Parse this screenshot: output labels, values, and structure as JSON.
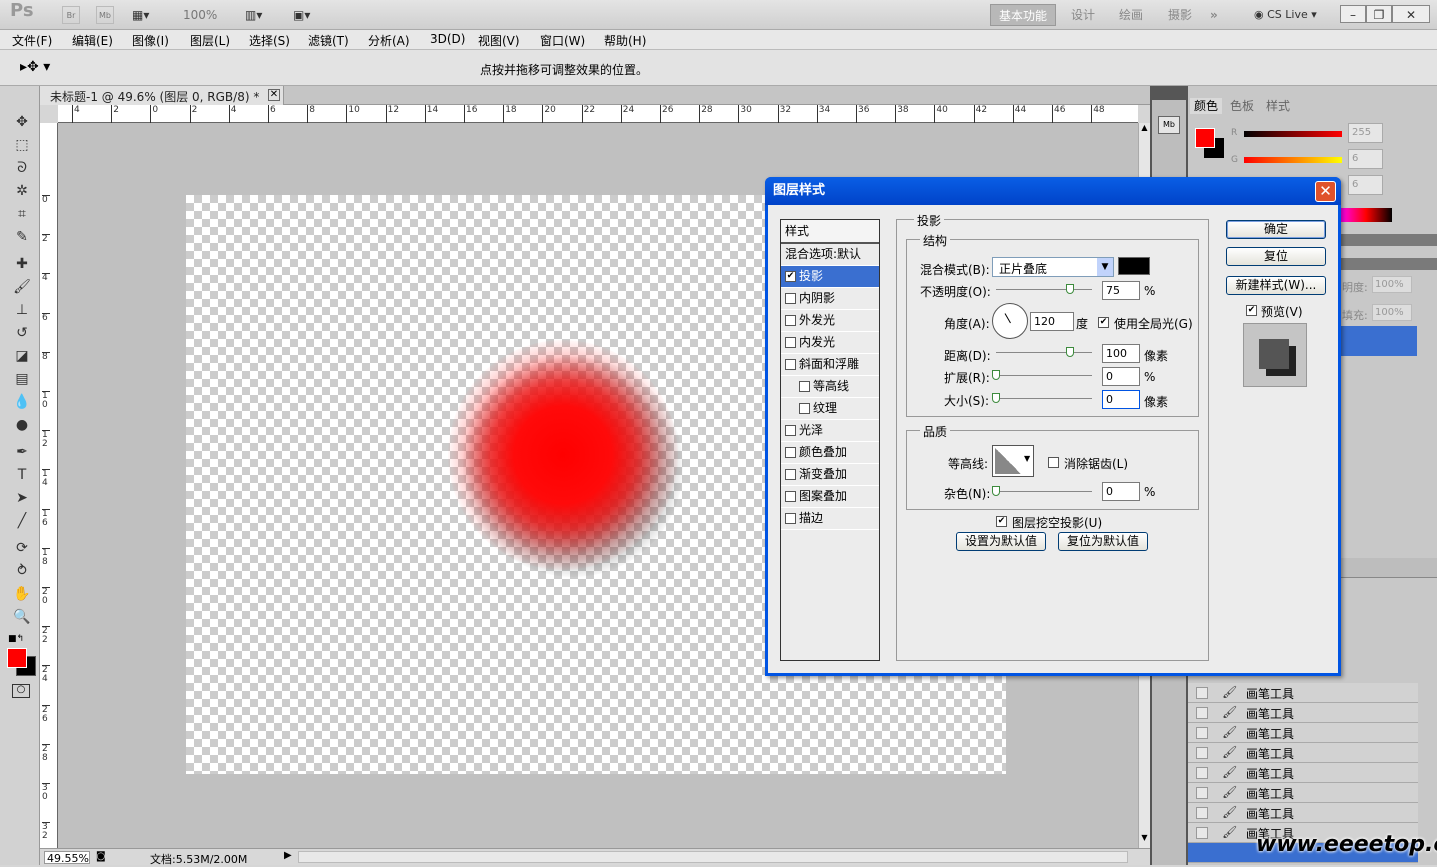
{
  "app": {
    "logo": "Ps",
    "zoom": "100%",
    "cslive": "CS Live"
  },
  "workspaces": [
    "基本功能",
    "设计",
    "绘画",
    "摄影"
  ],
  "menu": [
    "文件(F)",
    "编辑(E)",
    "图像(I)",
    "图层(L)",
    "选择(S)",
    "滤镜(T)",
    "分析(A)",
    "3D(D)",
    "视图(V)",
    "窗口(W)",
    "帮助(H)"
  ],
  "options_hint": "点按并拖移可调整效果的位置。",
  "document": {
    "tab_title": "未标题-1 @ 49.6% (图层 0, RGB/8) *",
    "zoom": "49.55%",
    "doc_size": "文档:5.53M/2.00M"
  },
  "ruler_h": [
    "4",
    "2",
    "0",
    "2",
    "4",
    "6",
    "8",
    "10",
    "12",
    "14",
    "16",
    "18",
    "20",
    "22",
    "24",
    "26",
    "28",
    "30",
    "32",
    "34",
    "36",
    "38",
    "40",
    "42",
    "44",
    "46",
    "48"
  ],
  "ruler_v": [
    "0",
    "2",
    "4",
    "6",
    "8",
    "1 0",
    "1 2",
    "1 4",
    "1 6",
    "1 8",
    "2 0",
    "2 2",
    "2 4",
    "2 6",
    "2 8",
    "3 0",
    "3 2"
  ],
  "panels": {
    "tabs": [
      "颜色",
      "色板",
      "样式"
    ],
    "color": {
      "r_label": "R",
      "g_label": "G",
      "r_value": "255",
      "g_value": "6",
      "b_value": "6"
    },
    "opacity_label": "明度:",
    "opacity_value": "100%",
    "fill_label": "填充:",
    "fill_value": "100%",
    "history_items": [
      "画笔工具",
      "画笔工具",
      "画笔工具",
      "画笔工具",
      "画笔工具",
      "画笔工具",
      "画笔工具",
      "画笔工具"
    ]
  },
  "dialog": {
    "title": "图层样式",
    "close": "✕",
    "styles_header": "样式",
    "styles": [
      {
        "label": "混合选项:默认",
        "checkbox": false,
        "checked": false,
        "indent": false,
        "active": false
      },
      {
        "label": "投影",
        "checkbox": true,
        "checked": true,
        "indent": false,
        "active": true
      },
      {
        "label": "内阴影",
        "checkbox": true,
        "checked": false,
        "indent": false,
        "active": false
      },
      {
        "label": "外发光",
        "checkbox": true,
        "checked": false,
        "indent": false,
        "active": false
      },
      {
        "label": "内发光",
        "checkbox": true,
        "checked": false,
        "indent": false,
        "active": false
      },
      {
        "label": "斜面和浮雕",
        "checkbox": true,
        "checked": false,
        "indent": false,
        "active": false
      },
      {
        "label": "等高线",
        "checkbox": true,
        "checked": false,
        "indent": true,
        "active": false
      },
      {
        "label": "纹理",
        "checkbox": true,
        "checked": false,
        "indent": true,
        "active": false
      },
      {
        "label": "光泽",
        "checkbox": true,
        "checked": false,
        "indent": false,
        "active": false
      },
      {
        "label": "颜色叠加",
        "checkbox": true,
        "checked": false,
        "indent": false,
        "active": false
      },
      {
        "label": "渐变叠加",
        "checkbox": true,
        "checked": false,
        "indent": false,
        "active": false
      },
      {
        "label": "图案叠加",
        "checkbox": true,
        "checked": false,
        "indent": false,
        "active": false
      },
      {
        "label": "描边",
        "checkbox": true,
        "checked": false,
        "indent": false,
        "active": false
      }
    ],
    "section_title": "投影",
    "structure_title": "结构",
    "blend_mode_label": "混合模式(B):",
    "blend_mode_value": "正片叠底",
    "opacity_label": "不透明度(O):",
    "opacity_value": "75",
    "percent": "%",
    "angle_label": "角度(A):",
    "angle_value": "120",
    "degree": "度",
    "global_light_label": "使用全局光(G)",
    "distance_label": "距离(D):",
    "distance_value": "100",
    "pixels": "像素",
    "spread_label": "扩展(R):",
    "spread_value": "0",
    "size_label": "大小(S):",
    "size_value": "0",
    "quality_title": "品质",
    "contour_label": "等高线:",
    "antialias_label": "消除锯齿(L)",
    "noise_label": "杂色(N):",
    "noise_value": "0",
    "knockout_label": "图层挖空投影(U)",
    "make_default": "设置为默认值",
    "reset_default": "复位为默认值",
    "ok": "确定",
    "reset": "复位",
    "new_style": "新建样式(W)...",
    "preview_label": "预览(V)"
  },
  "watermark": "www.eeeetop.com",
  "colors": {
    "foreground": "#ff0000",
    "background": "#000000",
    "accent": "#0054e3"
  }
}
